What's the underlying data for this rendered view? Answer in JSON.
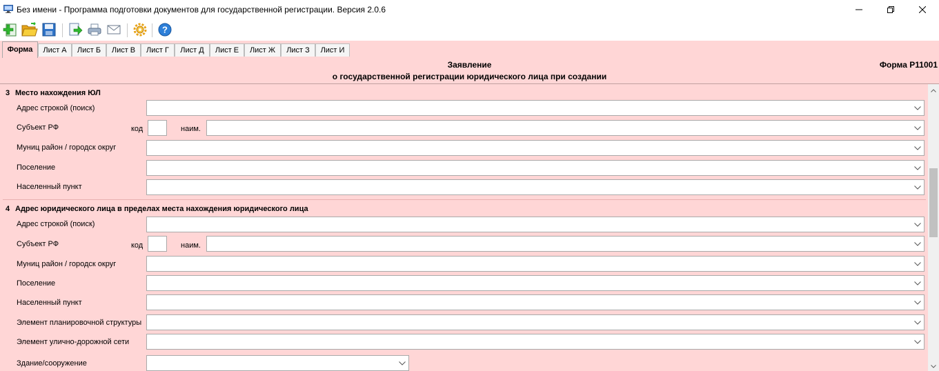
{
  "window": {
    "title": "Без имени - Программа подготовки документов для государственной регистрации. Версия 2.0.6",
    "icons": [
      "app-monitor-icon",
      "minimize-icon",
      "restore-icon",
      "close-icon"
    ]
  },
  "toolbar": {
    "buttons": [
      "new-document-icon",
      "open-folder-icon",
      "save-disk-icon",
      "export-icon",
      "print-icon",
      "email-icon",
      "settings-gear-icon",
      "help-icon"
    ]
  },
  "tabs": [
    "Форма",
    "Лист А",
    "Лист Б",
    "Лист В",
    "Лист Г",
    "Лист Д",
    "Лист Е",
    "Лист Ж",
    "Лист З",
    "Лист И"
  ],
  "active_tab": "Форма",
  "form": {
    "title_line1": "Заявление",
    "title_line2": "о государственной регистрации юридического лица при создании",
    "code": "Форма Р11001"
  },
  "section3": {
    "number": "3",
    "title": "Место нахождения ЮЛ",
    "address_label": "Адрес строкой (поиск)",
    "subject_label": "Субъект РФ",
    "code_label": "код",
    "name_label": "наим.",
    "municipal_label": "Муниц район / городск округ",
    "settlement_label": "Поселение",
    "locality_label": "Населенный пункт"
  },
  "section4": {
    "number": "4",
    "title": "Адрес юридического лица в пределах места нахождения юридического лица",
    "address_label": "Адрес строкой (поиск)",
    "subject_label": "Субъект РФ",
    "code_label": "код",
    "name_label": "наим.",
    "municipal_label": "Муниц район / городск округ",
    "settlement_label": "Поселение",
    "locality_label": "Населенный пункт",
    "planning_label": "Элемент планировочной структуры",
    "street_label": "Элемент улично-дорожной сети",
    "building_label": "Здание/сооружение"
  },
  "colors": {
    "form_background": "#ffd6d6",
    "field_background": "#ffffff",
    "field_border": "#a9a9a9"
  }
}
